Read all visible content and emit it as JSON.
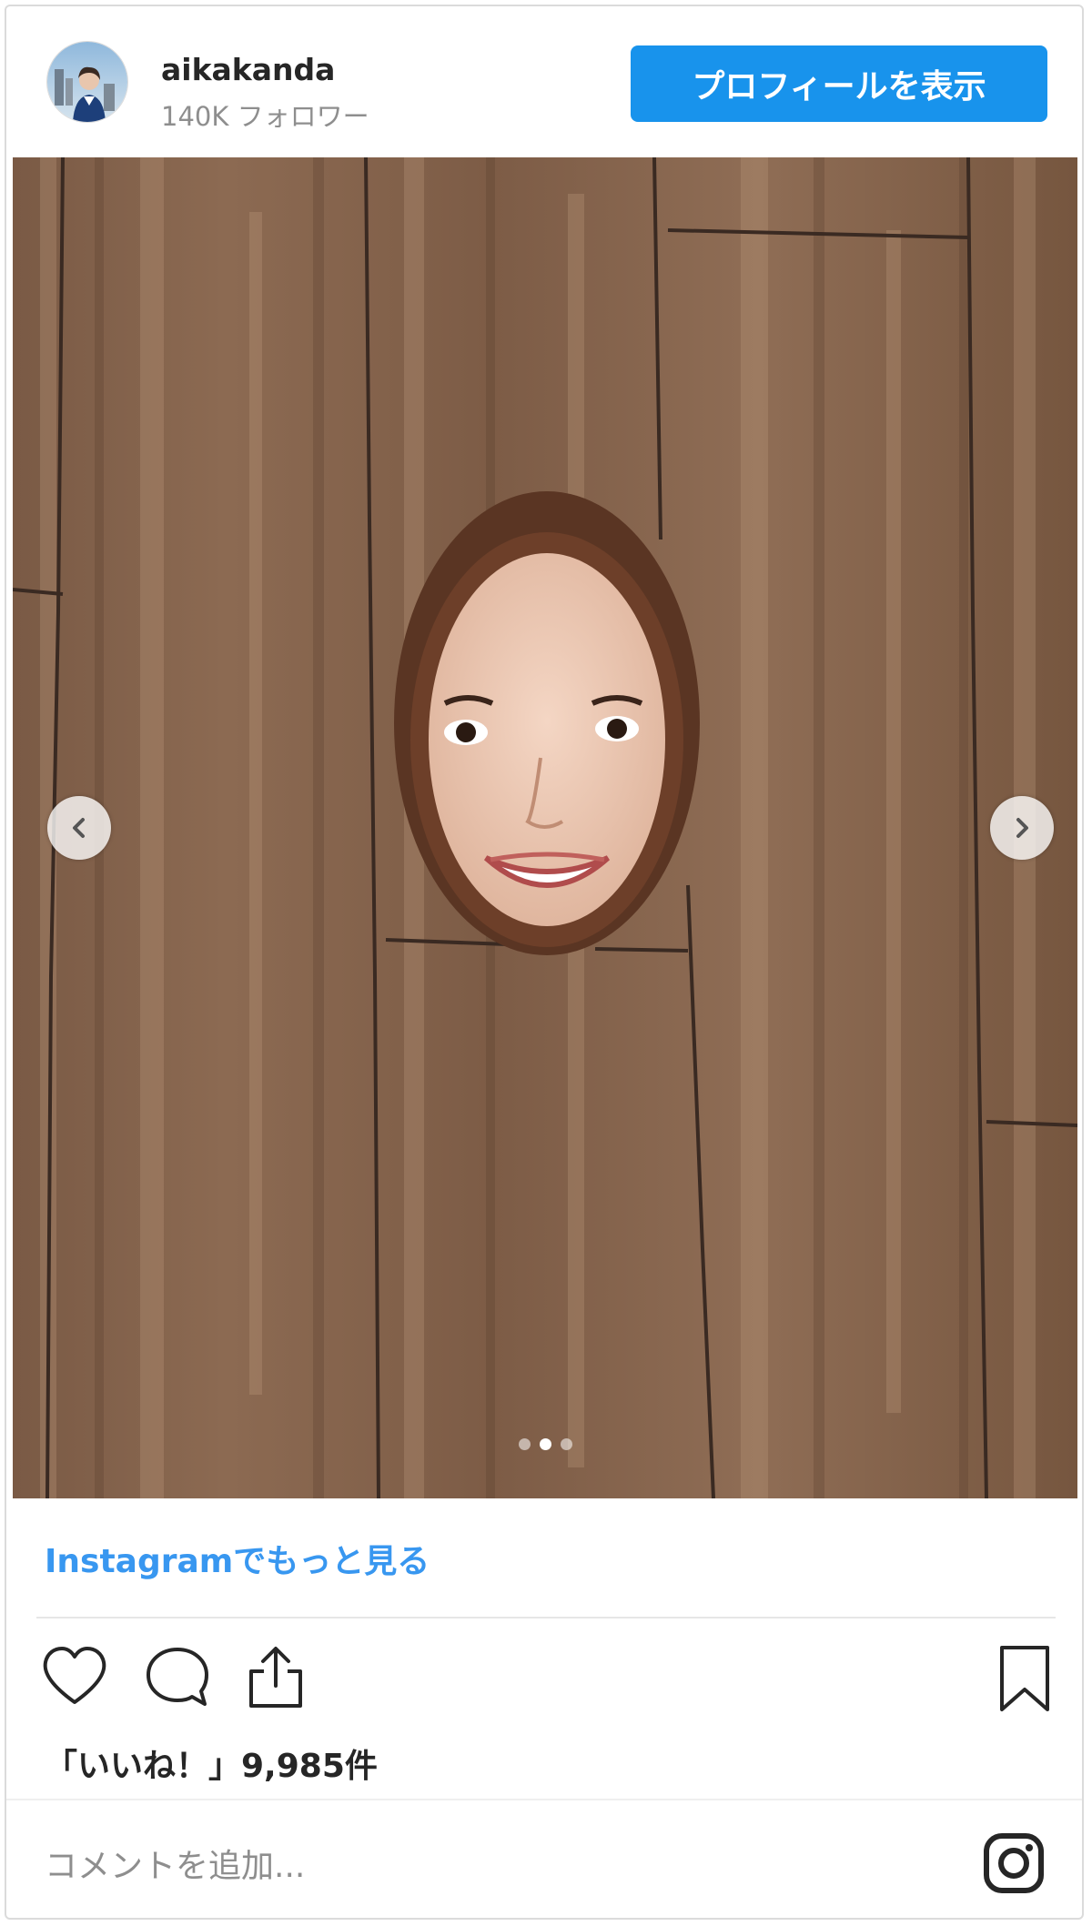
{
  "header": {
    "username": "aikakanda",
    "followers": "140K フォロワー",
    "profile_button": "プロフィールを表示"
  },
  "carousel": {
    "current_slide": 2,
    "slide_count": 3
  },
  "more_link": "Instagramでもっと見る",
  "likes": "「いいね！」9,985件",
  "comment_placeholder": "コメントを追加...",
  "colors": {
    "accent": "#1893ec",
    "link": "#3897f0",
    "muted": "#8e8e8e",
    "text": "#262626"
  },
  "icons": [
    "heart-icon",
    "comment-icon",
    "share-icon",
    "bookmark-icon",
    "instagram-icon",
    "chevron-left-icon",
    "chevron-right-icon"
  ]
}
